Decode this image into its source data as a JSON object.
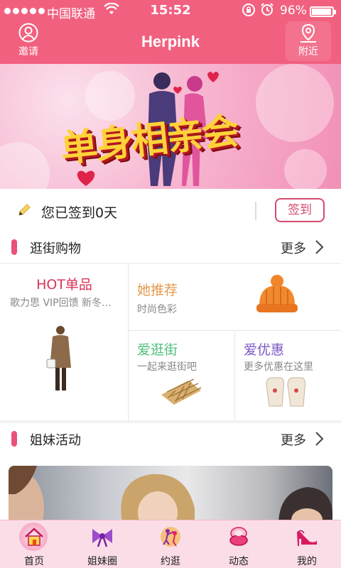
{
  "status_bar": {
    "carrier": "中国联通",
    "time": "15:52",
    "battery_percent": "96%",
    "battery_level": 0.96
  },
  "header": {
    "title": "Herpink",
    "left_button": "邀请",
    "right_button": "附近"
  },
  "banner": {
    "text": "单身相亲会"
  },
  "checkin": {
    "status_text": "您已签到0天",
    "button_label": "签到"
  },
  "shopping": {
    "title": "逛街购物",
    "more": "更多",
    "tiles": [
      {
        "title": "HOT单品",
        "subtitle": "歌力思 VIP回馈 新冬…"
      },
      {
        "title": "她推荐",
        "subtitle": "时尚色彩"
      },
      {
        "title": "爱逛街",
        "subtitle": "一起来逛街吧"
      },
      {
        "title": "爱优惠",
        "subtitle": "更多优惠在这里"
      }
    ]
  },
  "activities": {
    "title": "姐妹活动",
    "more": "更多"
  },
  "tabbar": {
    "items": [
      {
        "label": "首页",
        "icon": "home-icon",
        "active": true
      },
      {
        "label": "姐妹圈",
        "icon": "bow-icon"
      },
      {
        "label": "约逛",
        "icon": "dance-icon"
      },
      {
        "label": "动态",
        "icon": "compact-mirror-icon"
      },
      {
        "label": "我的",
        "icon": "high-heel-icon"
      }
    ]
  },
  "colors": {
    "brand_pink": "#f2607f",
    "accent_red": "#d44a6c",
    "tabbar_bg": "#fbdde8"
  }
}
